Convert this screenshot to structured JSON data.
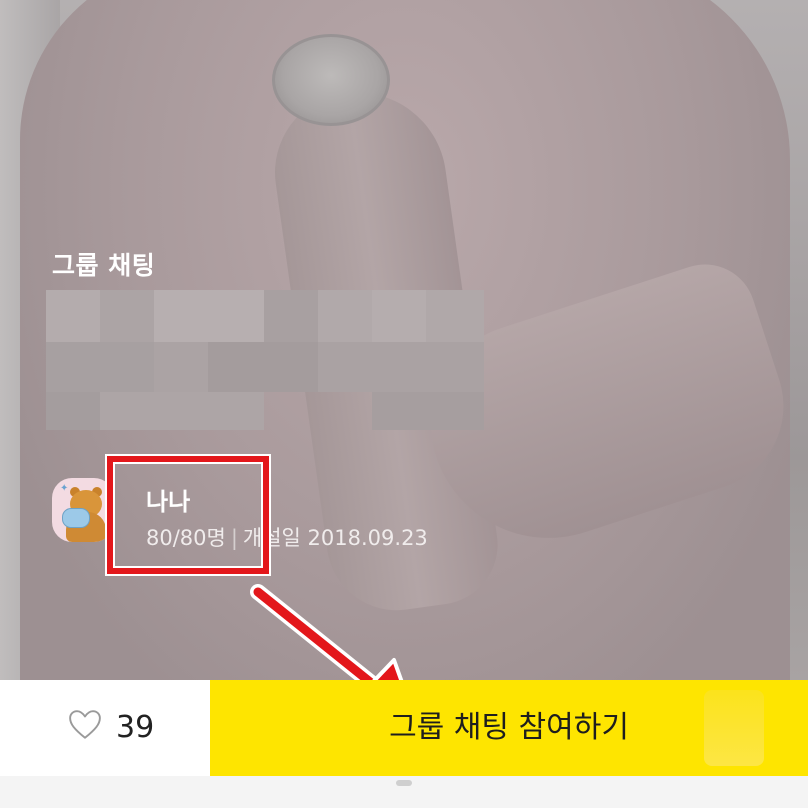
{
  "room": {
    "section_title": "그룹 채팅",
    "name": "나나",
    "members": "80/80명",
    "separator": "|",
    "created": "개설일 2018.09.23"
  },
  "actions": {
    "like_count": "39",
    "join_label": "그룹 채팅 참여하기"
  },
  "colors": {
    "join_button": "#fee500",
    "highlight": "#e3171b",
    "avatar_bg": "#f3dbe2"
  },
  "icons": {
    "like": "heart-icon",
    "avatar": "bear-avatar-icon",
    "annotation": "arrow-icon"
  }
}
